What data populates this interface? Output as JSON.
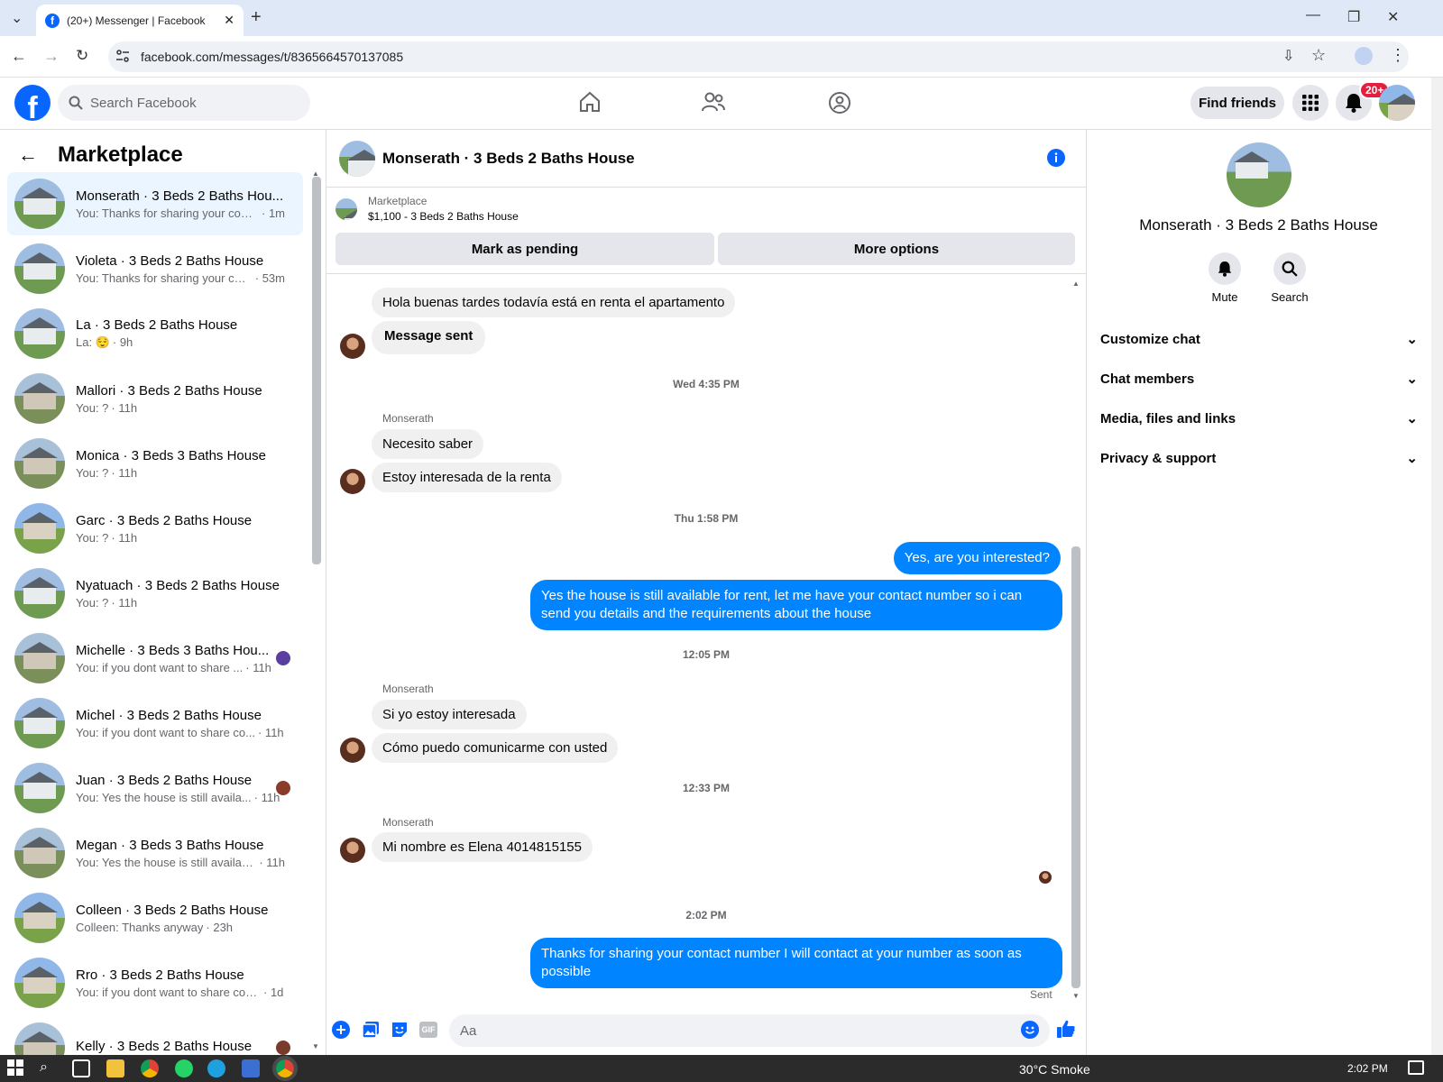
{
  "browser": {
    "tab_title": "(20+) Messenger | Facebook",
    "url": "facebook.com/messages/t/8365664570137085"
  },
  "header": {
    "search_placeholder": "Search Facebook",
    "find_friends": "Find friends",
    "notification_badge": "20+"
  },
  "sidebar": {
    "title": "Marketplace",
    "conversations": [
      {
        "name": "Monserath · 3 Beds 2 Baths Hou...",
        "preview": "You: Thanks for sharing your conta...",
        "time": "· 1m",
        "selected": true
      },
      {
        "name": "Violeta · 3 Beds 2 Baths House",
        "preview": "You: Thanks for sharing your con...",
        "time": "· 53m"
      },
      {
        "name": "La · 3 Beds 2 Baths House",
        "preview": "La: 😌",
        "time": "· 9h"
      },
      {
        "name": "Mallori · 3 Beds 2 Baths House",
        "preview": "You: ?",
        "time": "· 11h"
      },
      {
        "name": "Monica · 3 Beds 3 Baths House",
        "preview": "You: ?",
        "time": "· 11h"
      },
      {
        "name": "Garc · 3 Beds 2 Baths House",
        "preview": "You: ?",
        "time": "· 11h"
      },
      {
        "name": "Nyatuach · 3 Beds 2 Baths House",
        "preview": "You: ?",
        "time": "· 11h"
      },
      {
        "name": "Michelle · 3 Beds 3 Baths Hou...",
        "preview": "You: if you dont want to share ...",
        "time": "· 11h"
      },
      {
        "name": "Michel · 3 Beds 2 Baths House",
        "preview": "You: if you dont want to share co...",
        "time": "· 11h"
      },
      {
        "name": "Juan · 3 Beds 2 Baths House",
        "preview": "You: Yes the house is still availa...",
        "time": "· 11h"
      },
      {
        "name": "Megan · 3 Beds 3 Baths House",
        "preview": "You: Yes the house is still available...",
        "time": "· 11h"
      },
      {
        "name": "Colleen · 3 Beds 2 Baths House",
        "preview": "Colleen: Thanks anyway",
        "time": "· 23h"
      },
      {
        "name": "Rro · 3 Beds 2 Baths House",
        "preview": "You: if you dont want to share cont...",
        "time": "· 1d"
      },
      {
        "name": "Kelly · 3 Beds 2 Baths House",
        "preview": "",
        "time": ""
      }
    ]
  },
  "chat": {
    "title": "Monserath · 3 Beds 2 Baths House",
    "marketplace_label": "Marketplace",
    "listing": "$1,100 - 3 Beds 2 Baths House",
    "mark_pending": "Mark as pending",
    "more_options": "More options",
    "messages": {
      "m1": "Hola buenas tardes todavía está en renta el apartamento",
      "m2": "Message sent",
      "ts1": "Wed 4:35 PM",
      "sender1": "Monserath",
      "m3": "Necesito saber",
      "m4": "Estoy interesada de la renta",
      "ts2": "Thu 1:58 PM",
      "m5": "Yes, are you interested?",
      "m6": "Yes the house is still available for rent, let me have your contact number so i can send you details and the requirements about the house",
      "ts3": "12:05 PM",
      "sender2": "Monserath",
      "m7": "Si yo estoy interesada",
      "m8": "Cómo puedo comunicarme con usted",
      "ts4": "12:33 PM",
      "sender3": "Monserath",
      "m9": "Mi nombre es Elena 4014815155",
      "ts5": "2:02 PM",
      "m10": "Thanks for sharing your contact number I will contact at your number as soon as possible",
      "status": "Sent"
    },
    "input_placeholder": "Aa"
  },
  "details": {
    "name": "Monserath · 3 Beds 2 Baths House",
    "mute": "Mute",
    "search": "Search",
    "sections": [
      "Customize chat",
      "Chat members",
      "Media, files and links",
      "Privacy & support"
    ]
  },
  "taskbar": {
    "weather": "30°C  Smoke",
    "time": "2:02 PM"
  },
  "colors": {
    "brand": "#0866ff",
    "bubble_out": "#0084ff",
    "bubble_in": "#f0f0f0",
    "selected": "#ebf5ff"
  }
}
